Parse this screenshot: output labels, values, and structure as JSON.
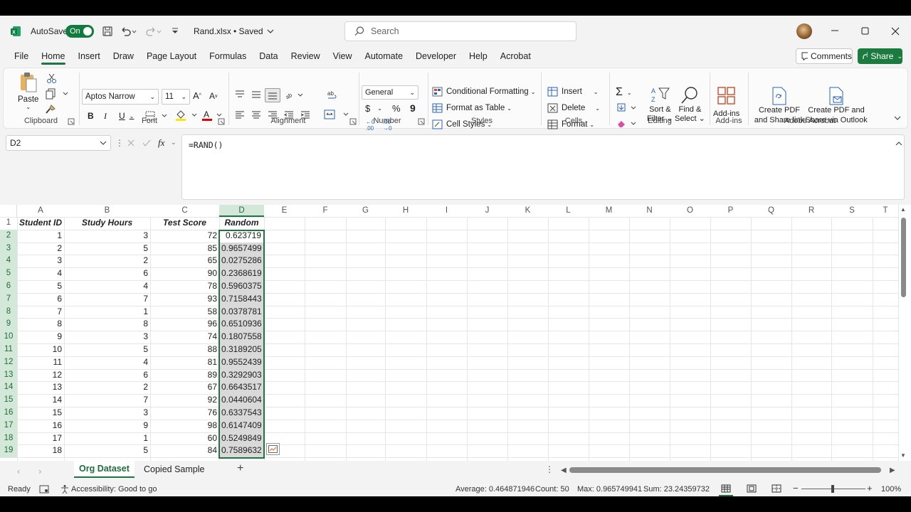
{
  "titlebar": {
    "autosave_label": "AutoSave",
    "autosave_state": "On",
    "file_title": "Rand.xlsx • Saved",
    "search_placeholder": "Search"
  },
  "menu": [
    "File",
    "Home",
    "Insert",
    "Draw",
    "Page Layout",
    "Formulas",
    "Data",
    "Review",
    "View",
    "Automate",
    "Developer",
    "Help",
    "Acrobat"
  ],
  "menu_active": "Home",
  "comments_label": "Comments",
  "share_label": "Share",
  "ribbon": {
    "clipboard": {
      "paste": "Paste",
      "label": "Clipboard"
    },
    "font": {
      "family": "Aptos Narrow",
      "size": "11",
      "label": "Font"
    },
    "alignment": {
      "label": "Alignment"
    },
    "number": {
      "format": "General",
      "label": "Number"
    },
    "styles": {
      "cond": "Conditional Formatting",
      "table": "Format as Table",
      "cell": "Cell Styles",
      "label": "Styles"
    },
    "cells": {
      "insert": "Insert",
      "delete": "Delete",
      "format": "Format",
      "label": "Cells"
    },
    "editing": {
      "sort1": "Sort &",
      "sort2": "Filter",
      "find1": "Find &",
      "find2": "Select",
      "label": "Editing"
    },
    "addins": {
      "btn": "Add-ins",
      "label": "Add-ins"
    },
    "acrobat": {
      "pdf1a": "Create PDF",
      "pdf1b": "and Share link",
      "pdf2a": "Create PDF and",
      "pdf2b": "Share via Outlook",
      "label": "Adobe Acrobat"
    }
  },
  "formula": {
    "namebox": "D2",
    "fx": "fx",
    "content": "=RAND()"
  },
  "columns": [
    "A",
    "B",
    "C",
    "D",
    "E",
    "F",
    "G",
    "H",
    "I",
    "J",
    "K",
    "L",
    "M",
    "N",
    "O",
    "P",
    "Q",
    "R",
    "S",
    "T"
  ],
  "headers": [
    "Student ID",
    "Study Hours",
    "Test Score",
    "Random"
  ],
  "rows": [
    [
      "1",
      "3",
      "72",
      "0.623719"
    ],
    [
      "2",
      "5",
      "85",
      "0.9657499"
    ],
    [
      "3",
      "2",
      "65",
      "0.0275286"
    ],
    [
      "4",
      "6",
      "90",
      "0.2368619"
    ],
    [
      "5",
      "4",
      "78",
      "0.5960375"
    ],
    [
      "6",
      "7",
      "93",
      "0.7158443"
    ],
    [
      "7",
      "1",
      "58",
      "0.0378781"
    ],
    [
      "8",
      "8",
      "96",
      "0.6510936"
    ],
    [
      "9",
      "3",
      "74",
      "0.1807558"
    ],
    [
      "10",
      "5",
      "88",
      "0.3189205"
    ],
    [
      "11",
      "4",
      "81",
      "0.9552439"
    ],
    [
      "12",
      "6",
      "89",
      "0.3292903"
    ],
    [
      "13",
      "2",
      "67",
      "0.6643517"
    ],
    [
      "14",
      "7",
      "92",
      "0.0440604"
    ],
    [
      "15",
      "3",
      "76",
      "0.6337543"
    ],
    [
      "16",
      "9",
      "98",
      "0.6147409"
    ],
    [
      "17",
      "1",
      "60",
      "0.5249849"
    ],
    [
      "18",
      "5",
      "84",
      "0.7589632"
    ]
  ],
  "sheets": [
    "Org Dataset",
    "Copied Sample"
  ],
  "active_sheet": "Org Dataset",
  "status": {
    "ready": "Ready",
    "accessibility": "Accessibility: Good to go",
    "average": "Average: 0.464871946",
    "count": "Count: 50",
    "max": "Max: 0.965749941",
    "sum": "Sum: 23.24359732",
    "zoom": "100%"
  },
  "colors": {
    "accent": "#217346",
    "selection_fill": "#d9d9d9"
  }
}
